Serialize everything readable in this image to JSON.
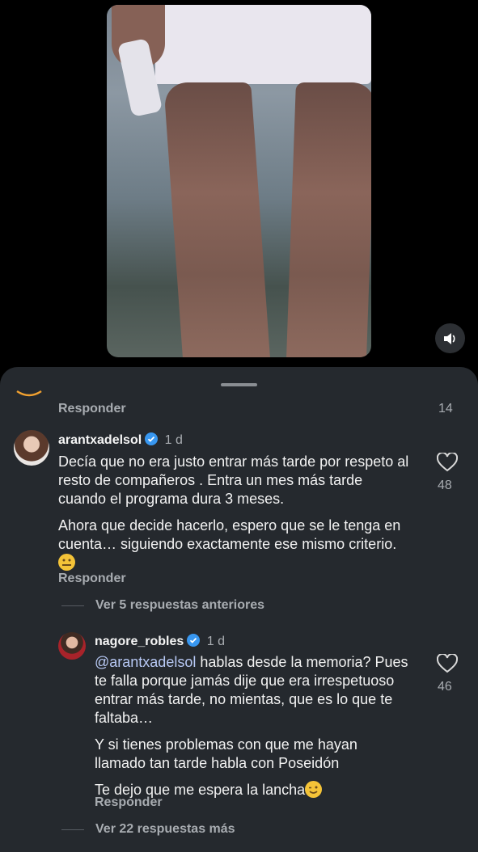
{
  "video": {
    "sound_icon": "speaker-icon"
  },
  "thread": {
    "prev_reply_label": "Responder",
    "prev_like_count": "14",
    "comments": [
      {
        "username": "arantxadelsol",
        "time": "1 d",
        "paragraphs": [
          "Decía que no era justo entrar más tarde por respeto al resto de compañeros . Entra un mes más tarde cuando el programa dura 3 meses.",
          "Ahora que decide hacerlo, espero que se le tenga en cuenta… siguiendo exactamente ese mismo criterio."
        ],
        "emoji": "🤐",
        "reply_label": "Responder",
        "like_count": "48"
      },
      {
        "username": "nagore_robles",
        "time": "1 d",
        "mention": "@arantxadelsol",
        "paragraphs": [
          "hablas desde la memoria? Pues te falla porque jamás dije que era irrespetuoso entrar más tarde, no mientas, que es lo que te faltaba…",
          "Y si tienes problemas con que me hayan llamado tan tarde habla con Poseidón",
          "Te dejo que me espera la lancha"
        ],
        "emoji": "😉",
        "reply_label": "Responder",
        "like_count": "46"
      }
    ],
    "view_previous": "Ver 5 respuestas anteriores",
    "view_more": "Ver 22 respuestas más"
  }
}
